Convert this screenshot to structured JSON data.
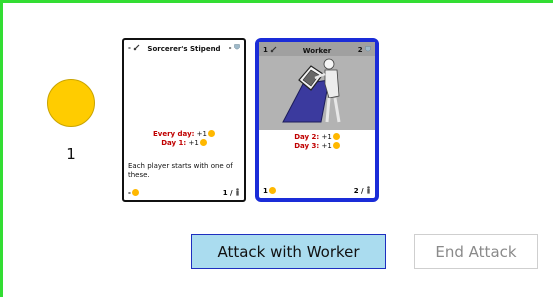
{
  "player": {
    "coin_count": "1",
    "coin_color": "#ffcc00"
  },
  "cards": [
    {
      "title": "Sorcerer's Stipend",
      "header_left": "-",
      "header_right": "-",
      "effects": [
        {
          "label": "Every day:",
          "value": "+1"
        },
        {
          "label": "Day 1:",
          "value": "+1"
        }
      ],
      "description": "Each player starts with one of these.",
      "cost": "-",
      "footer_right": "1 /"
    },
    {
      "title": "Worker",
      "header_left": "1",
      "header_right": "2",
      "effects": [
        {
          "label": "Day 2:",
          "value": "+1"
        },
        {
          "label": "Day 3:",
          "value": "+1"
        }
      ],
      "cost": "1",
      "footer_right": "2 /"
    }
  ],
  "actions": {
    "attack_label": "Attack with Worker",
    "end_label": "End Attack"
  },
  "colors": {
    "frame": "#33dd33",
    "selected_border": "#1a2cd8",
    "attack_bg": "#aadcef",
    "effect_red": "#c00000",
    "coin": "#ffb800"
  },
  "icons": {
    "header_sword": "sword-icon",
    "header_shield": "shield-icon",
    "footer_person": "person-icon"
  }
}
